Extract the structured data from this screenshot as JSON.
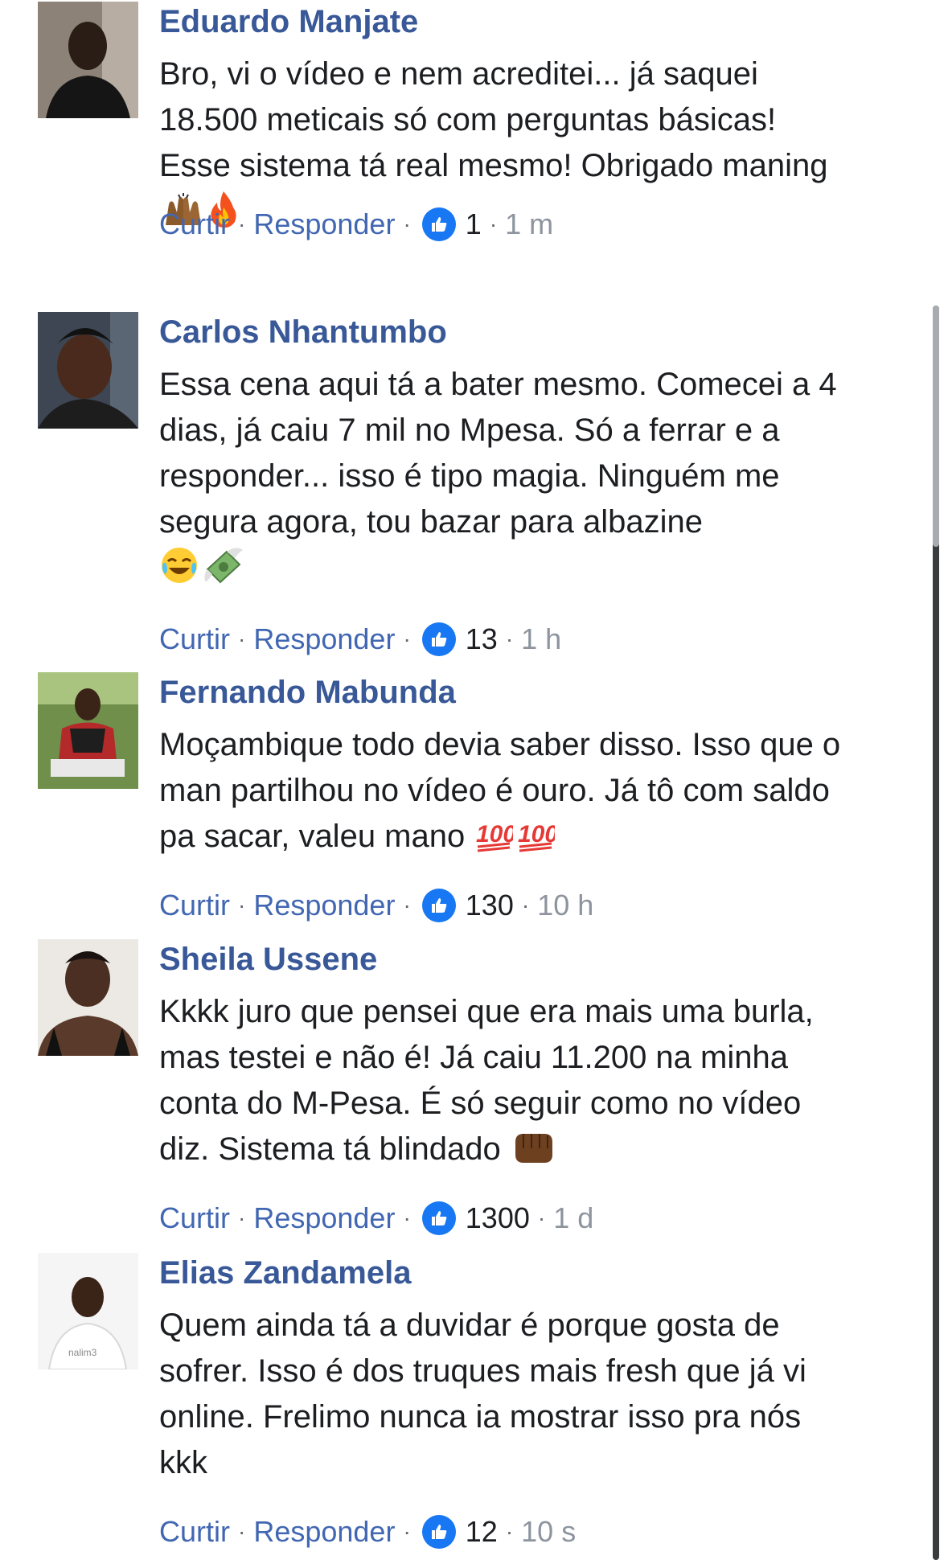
{
  "labels": {
    "like": "Curtir",
    "reply": "Responder",
    "separator": "·"
  },
  "colors": {
    "name": "#385898",
    "action": "#4267b2",
    "like_badge": "#1877f2",
    "time": "#8d949e"
  },
  "comments": [
    {
      "name": "Eduardo Manjate",
      "text": "Bro, vi o vídeo e nem acreditei... já saquei 18.500 meticais só com perguntas básicas! Esse sistema tá real mesmo! Obrigado maning",
      "emojis": [
        "raising-hands-icon",
        "fire-icon"
      ],
      "likes": "1",
      "time": "1 m"
    },
    {
      "name": "Carlos Nhantumbo",
      "text": "Essa cena aqui tá a bater mesmo. Comecei a 4 dias, já caiu 7 mil no Mpesa. Só a ferrar e a responder... isso é tipo magia. Ninguém me segura agora, tou bazar para albazine",
      "emojis": [
        "laughing-tears-icon",
        "money-wings-icon"
      ],
      "likes": "13",
      "time": "1 h"
    },
    {
      "name": "Fernando Mabunda",
      "text": "Moçambique todo devia saber disso. Isso que o man partilhou no vídeo é ouro. Já tô com saldo pa sacar, valeu mano",
      "emojis": [
        "hundred-points-icon",
        "hundred-points-icon"
      ],
      "likes": "130",
      "time": "10 h"
    },
    {
      "name": "Sheila Ussene",
      "text": "Kkkk juro que pensei que era mais uma burla, mas testei e não é! Já caiu 11.200 na minha conta do M-Pesa. É só seguir como no vídeo diz. Sistema tá blindado",
      "emojis": [
        "fist-bump-icon"
      ],
      "likes": "1300",
      "time": "1 d"
    },
    {
      "name": "Elias Zandamela",
      "text": "Quem ainda tá a duvidar é porque gosta de sofrer. Isso é dos truques mais fresh que já vi online. Frelimo nunca ia mostrar isso pra nós kkk",
      "emojis": [],
      "likes": "12",
      "time": "10 s"
    }
  ]
}
